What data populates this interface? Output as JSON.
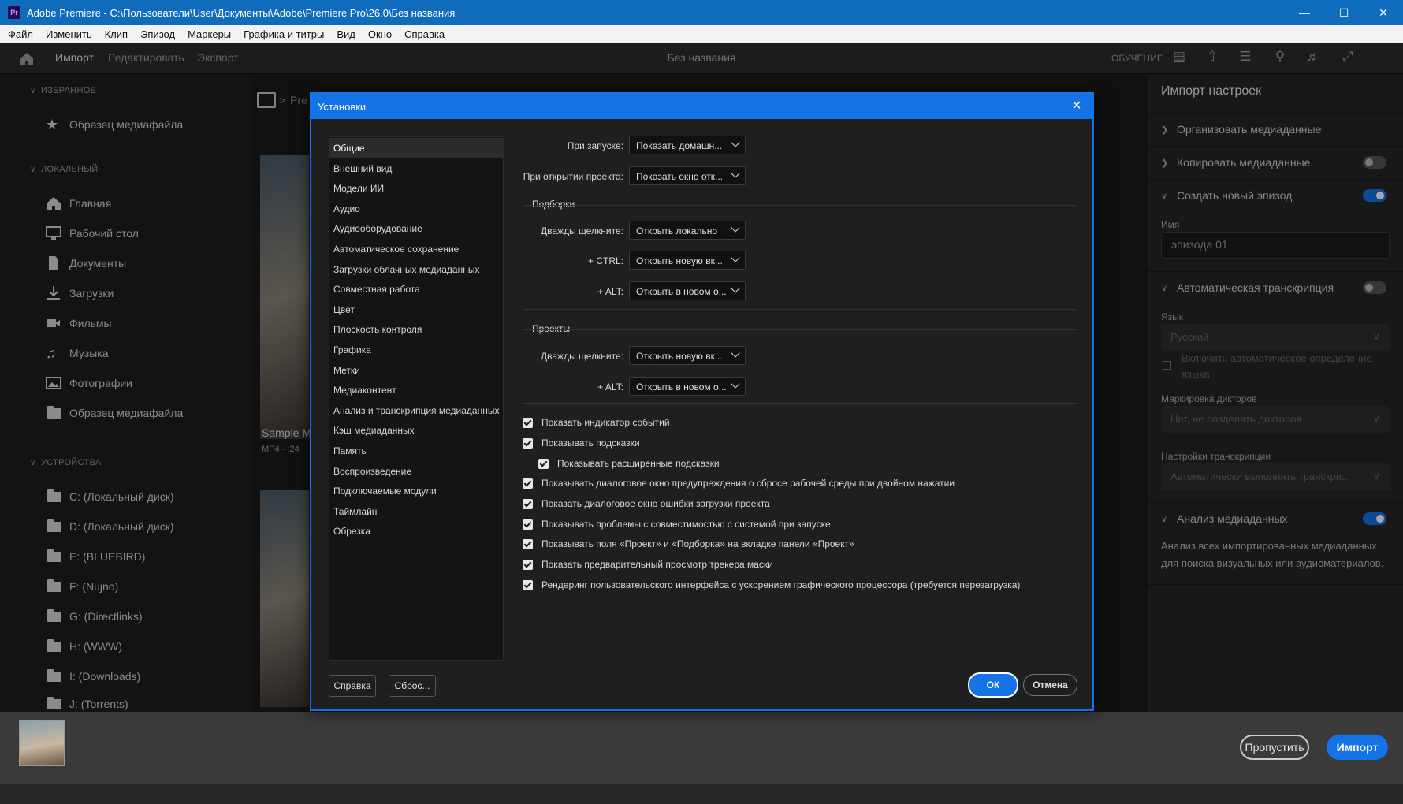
{
  "window": {
    "logo": "Pr",
    "title": "Adobe Premiere - C:\\Пользователи\\User\\Документы\\Adobe\\Premiere Pro\\26.0\\Без названия"
  },
  "menu": [
    "Файл",
    "Изменить",
    "Клип",
    "Эпизод",
    "Маркеры",
    "Графика и титры",
    "Вид",
    "Окно",
    "Справка"
  ],
  "header": {
    "tabs": [
      "Импорт",
      "Редактировать",
      "Экспорт"
    ],
    "active_tab": "Импорт",
    "project_name": "Без названия",
    "learn": "ОБУЧЕНИЕ"
  },
  "left_panel": {
    "favorites_title": "ИЗБРАННОЕ",
    "favorites": [
      "Образец медиафайла"
    ],
    "local_title": "ЛОКАЛЬНЫЙ",
    "local": [
      {
        "label": "Главная",
        "icon": "home-icon"
      },
      {
        "label": "Рабочий стол",
        "icon": "desktop-icon"
      },
      {
        "label": "Документы",
        "icon": "document-icon"
      },
      {
        "label": "Загрузки",
        "icon": "download-icon"
      },
      {
        "label": "Фильмы",
        "icon": "video-camera-icon"
      },
      {
        "label": "Музыка",
        "icon": "music-note-icon"
      },
      {
        "label": "Фотографии",
        "icon": "image-icon"
      },
      {
        "label": "Образец медиафайла",
        "icon": "folder-icon"
      }
    ],
    "devices_title": "УСТРОЙСТВА",
    "devices": [
      "C: (Локальный диск)",
      "D: (Локальный диск)",
      "E: (BLUEBIRD)",
      "F: (Nujno)",
      "G: (Directlinks)",
      "H: (WWW)",
      "I: (Downloads)",
      "J: (Torrents)"
    ]
  },
  "middle": {
    "breadcrumb": "Pre",
    "media_name": "Sample M",
    "media_meta": "MP4 - :24"
  },
  "right_panel": {
    "title": "Импорт настроек",
    "organize": "Организовать медиаданные",
    "copy": "Копировать медиаданные",
    "copy_on": false,
    "new_sequence": "Создать новый эпизод",
    "new_sequence_on": true,
    "name_label": "Имя",
    "name_value": "эпизода 01",
    "auto_transcribe": "Автоматическая транскрипция",
    "auto_transcribe_on": false,
    "lang_label": "Язык",
    "lang_value": "Русский",
    "auto_detect_line1": "Включить автоматическое определение",
    "auto_detect_line2": "языка",
    "speakers_label": "Маркировка дикторов",
    "speakers_value": "Нет, не разделять дикторов",
    "transcribe_settings_label": "Настройки транскрипции",
    "transcribe_settings_value": "Автоматически выполнять транскри...",
    "analysis": "Анализ медиаданных",
    "analysis_on": true,
    "analysis_desc_line1": "Анализ всех импортированных медиаданных",
    "analysis_desc_line2": "для поиска визуальных или аудиоматериалов."
  },
  "bottom": {
    "skip": "Пропустить",
    "import": "Импорт"
  },
  "dialog": {
    "title": "Установки",
    "categories": [
      "Общие",
      "Внешний вид",
      "Модели ИИ",
      "Аудио",
      "Аудиооборудование",
      "Автоматическое сохранение",
      "Загрузки облачных медиаданных",
      "Совместная работа",
      "Цвет",
      "Плоскость контроля",
      "Графика",
      "Метки",
      "Медиаконтент",
      "Анализ и транскрипция медиаданных",
      "Кэш медиаданных",
      "Память",
      "Воспроизведение",
      "Подключаемые модули",
      "Таймлайн",
      "Обрезка"
    ],
    "selected_category": "Общие",
    "on_start_label": "При запуске:",
    "on_start_value": "Показать домашн...",
    "on_open_label": "При открытии проекта:",
    "on_open_value": "Показать окно отк...",
    "bins_title": "Подборки",
    "bins_dbl_label": "Дважды щелкните:",
    "bins_dbl_value": "Открыть локально",
    "bins_ctrl_label": "+ CTRL:",
    "bins_ctrl_value": "Открыть новую вк...",
    "bins_alt_label": "+ ALT:",
    "bins_alt_value": "Открыть в новом о...",
    "projects_title": "Проекты",
    "proj_dbl_label": "Дважды щелкните:",
    "proj_dbl_value": "Открыть новую вк...",
    "proj_alt_label": "+ ALT:",
    "proj_alt_value": "Открыть в новом о...",
    "checkboxes": [
      {
        "label": "Показать индикатор событий",
        "checked": true,
        "indent": false
      },
      {
        "label": "Показывать подсказки",
        "checked": true,
        "indent": false
      },
      {
        "label": "Показывать расширенные подсказки",
        "checked": true,
        "indent": true
      },
      {
        "label": "Показывать диалоговое окно предупреждения о сбросе рабочей среды при двойном нажатии",
        "checked": true,
        "indent": false
      },
      {
        "label": "Показать диалоговое окно ошибки загрузки проекта",
        "checked": true,
        "indent": false
      },
      {
        "label": "Показывать проблемы с совместимостью с системой при запуске",
        "checked": true,
        "indent": false
      },
      {
        "label": "Показывать поля «Проект» и «Подборка» на вкладке панели «Проект»",
        "checked": true,
        "indent": false
      },
      {
        "label": "Показать предварительный просмотр трекера маски",
        "checked": true,
        "indent": false
      },
      {
        "label": "Рендеринг пользовательского интерфейса с ускорением графического процессора (требуется перезагрузка)",
        "checked": true,
        "indent": false
      }
    ],
    "help_button": "Справка",
    "reset_button": "Сброс...",
    "ok_button": "ОК",
    "cancel_button": "Отмена"
  }
}
